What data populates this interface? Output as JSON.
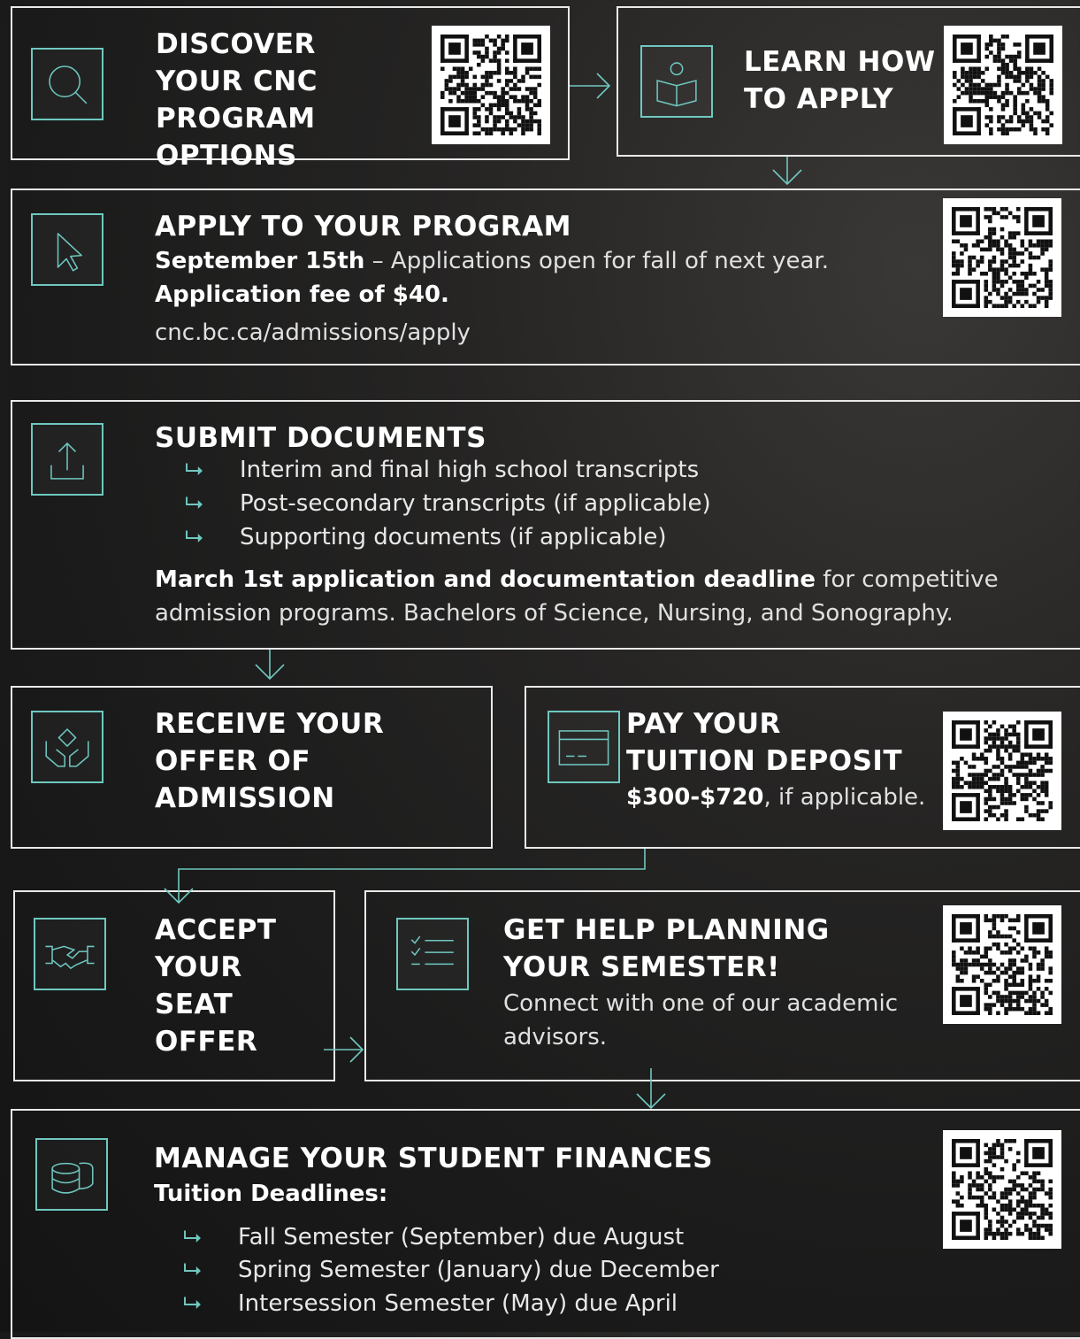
{
  "colors": {
    "accent": "#6fc8c0",
    "border": "#e9e9e9",
    "text": "#ffffff"
  },
  "discover": {
    "title": "DISCOVER YOUR CNC PROGRAM OPTIONS",
    "icon": "search-icon"
  },
  "learn": {
    "title": "LEARN HOW TO APPLY",
    "icon": "book-reader-icon"
  },
  "apply": {
    "title": "APPLY TO YOUR PROGRAM",
    "date_bold": "September 15th",
    "date_rest": " – Applications open for fall of next year.",
    "fee": "Application fee of $40.",
    "url": "cnc.bc.ca/admissions/apply",
    "icon": "cursor-icon"
  },
  "submit": {
    "title": "SUBMIT DOCUMENTS",
    "items": [
      "Interim and final high school transcripts",
      "Post-secondary transcripts (if applicable)",
      "Supporting documents (if applicable)"
    ],
    "deadline_bold": "March 1st application and documentation deadline",
    "deadline_rest": " for competitive",
    "deadline_line2": "admission programs. Bachelors of Science, Nursing, and Sonography.",
    "icon": "upload-icon"
  },
  "receive": {
    "title": "RECEIVE YOUR OFFER OF ADMISSION",
    "icon": "hands-diamond-icon"
  },
  "pay": {
    "title": "PAY YOUR TUITION DEPOSIT",
    "amount_bold": "$300-$720",
    "amount_rest": ", if applicable.",
    "icon": "credit-card-icon"
  },
  "accept": {
    "title": "ACCEPT YOUR SEAT OFFER",
    "icon": "handshake-icon"
  },
  "help": {
    "title": "GET HELP PLANNING YOUR SEMESTER!",
    "text": "Connect with one of our academic advisors.",
    "icon": "checklist-icon"
  },
  "finances": {
    "title": "MANAGE YOUR STUDENT FINANCES",
    "subtitle": "Tuition Deadlines:",
    "items": [
      "Fall Semester (September) due August",
      "Spring Semester (January) due December",
      "Intersession Semester (May) due April"
    ],
    "icon": "coins-icon"
  },
  "bullet_icon": "return-arrow-icon"
}
